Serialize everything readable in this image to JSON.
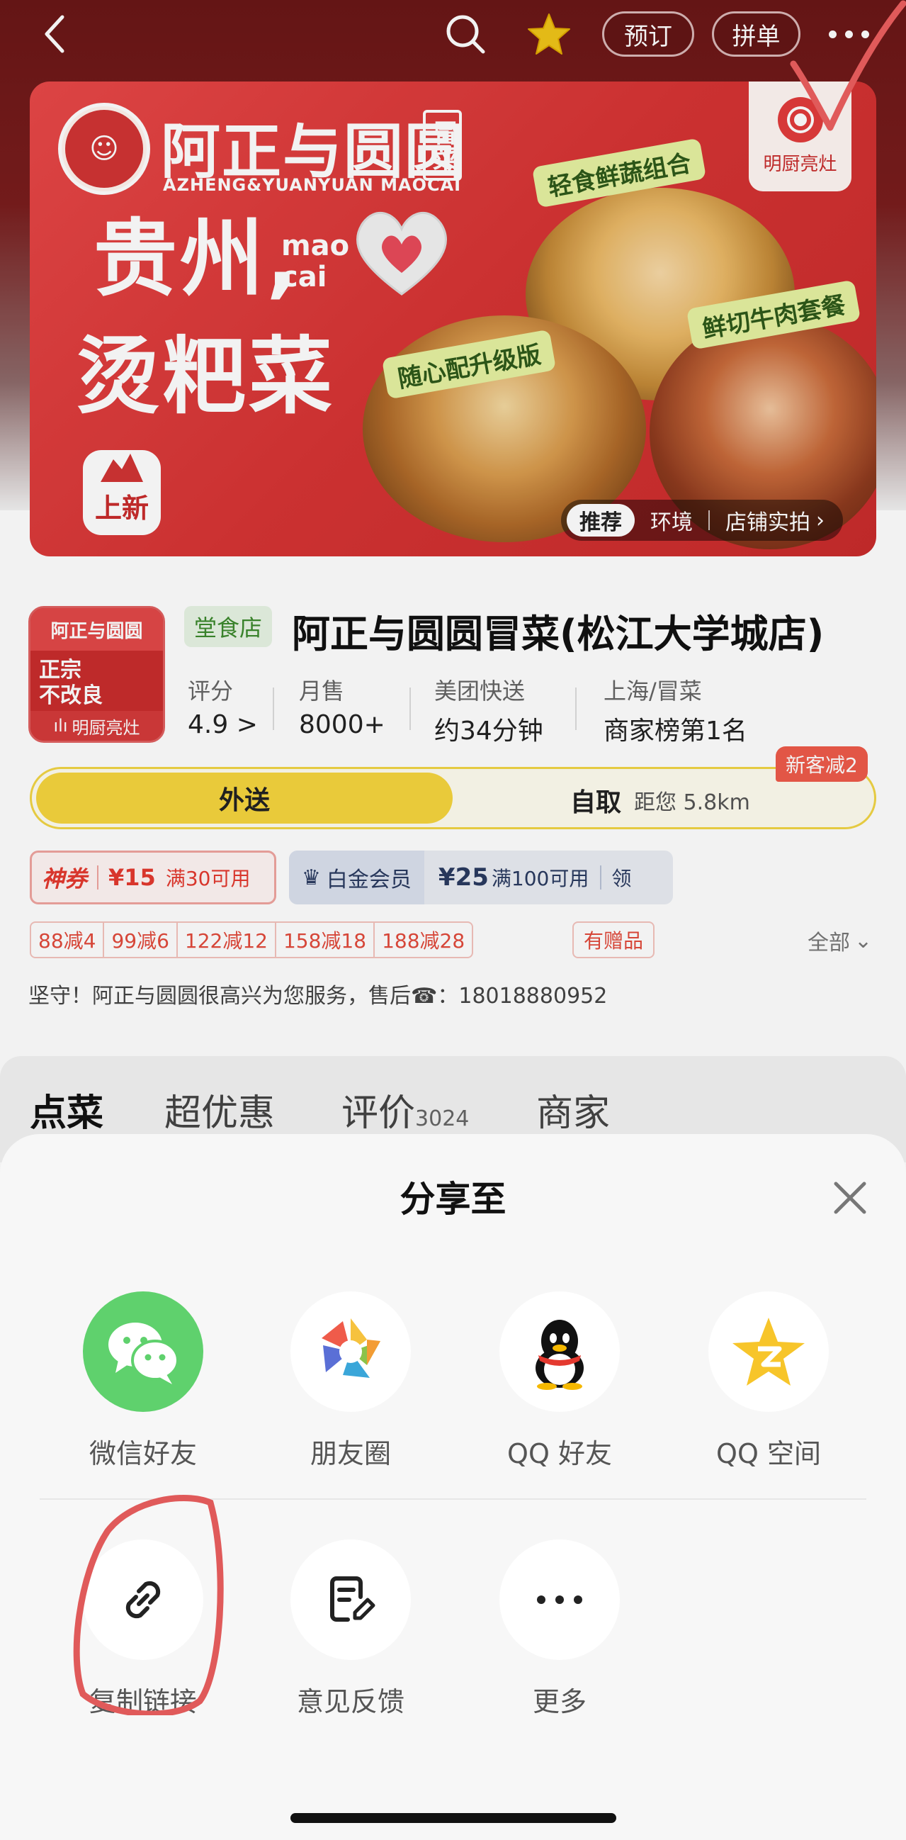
{
  "topbar": {
    "reserve_label": "预订",
    "group_label": "拼单"
  },
  "banner": {
    "brand_cn": "阿正与圆圆",
    "brand_tag": "冒菜",
    "brand_en": "AZHENG&YUANYUAN MAOCAI",
    "headline_1": "贵州,",
    "headline_en_1": "mao",
    "headline_en_2": "cai",
    "headline_2": "烫粑菜",
    "new_badge": "上新",
    "kitchen_badge": "明厨亮灶",
    "tag_1": "轻食鲜蔬组合",
    "tag_2": "随心配升级版",
    "tag_3": "鲜切牛肉套餐",
    "tabs": [
      "推荐",
      "环境",
      "店铺实拍"
    ]
  },
  "store": {
    "logo_top": "阿正与圆圆",
    "logo_mid_1": "正宗",
    "logo_mid_2": "不改良",
    "logo_bottom": "明厨亮灶",
    "dine_tag": "堂食店",
    "name": "阿正与圆圆冒菜(松江大学城店)",
    "stats": [
      {
        "label": "评分",
        "value": "4.9 >"
      },
      {
        "label": "月售",
        "value": "8000+"
      },
      {
        "label": "美团快送",
        "value": "约34分钟"
      },
      {
        "label": "上海/冒菜",
        "value": "商家榜第1名"
      }
    ]
  },
  "mode": {
    "deliver": "外送",
    "pickup": "自取",
    "distance": "距您 5.8km",
    "new_customer": "新客减2"
  },
  "coupons": {
    "shen_tag": "神券",
    "shen_amount": "¥15",
    "shen_cond": "满30可用",
    "vip_label": "白金会员",
    "vip_amount": "¥25",
    "vip_cond": "满100可用",
    "vip_claim": "领"
  },
  "discounts": [
    "88减4",
    "99减6",
    "122减12",
    "158减18",
    "188减28"
  ],
  "gift": "有赠品",
  "all_link": "全部",
  "notice": "坚守！阿正与圆圆很高兴为您服务，售后☎：18018880952",
  "tabs": {
    "order": "点菜",
    "deals": "超优惠",
    "reviews": "评价",
    "reviews_count": "3024",
    "merchant": "商家"
  },
  "share_sheet": {
    "title": "分享至",
    "items_row1": [
      "微信好友",
      "朋友圈",
      "QQ 好友",
      "QQ 空间"
    ],
    "items_row2": [
      "复制链接",
      "意见反馈",
      "更多"
    ]
  },
  "colors": {
    "brand_red": "#d63434",
    "wechat_green": "#5fd16d",
    "yellow": "#f6d53e",
    "annotation_red": "#e05a5a"
  }
}
